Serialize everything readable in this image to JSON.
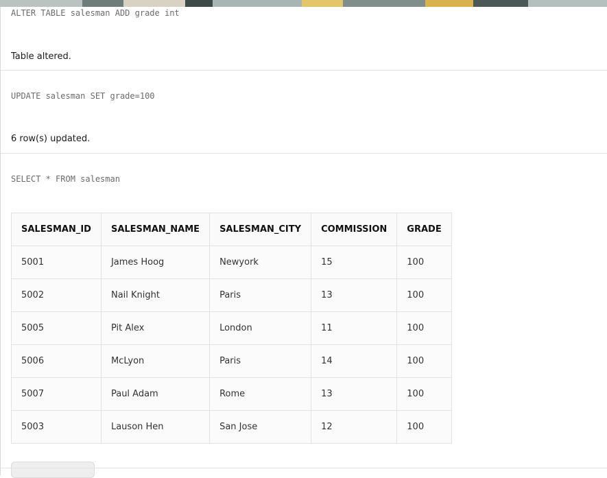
{
  "statements": [
    {
      "code": "ALTER TABLE salesman ADD grade int",
      "result": "Table altered."
    },
    {
      "code": "UPDATE salesman SET grade=100",
      "result": "6 row(s) updated."
    },
    {
      "code": "SELECT * FROM salesman",
      "result": ""
    }
  ],
  "table": {
    "headers": [
      "SALESMAN_ID",
      "SALESMAN_NAME",
      "SALESMAN_CITY",
      "COMMISSION",
      "GRADE"
    ],
    "rows": [
      [
        "5001",
        "James Hoog",
        "Newyork",
        "15",
        "100"
      ],
      [
        "5002",
        "Nail Knight",
        "Paris",
        "13",
        "100"
      ],
      [
        "5005",
        "Pit Alex",
        "London",
        "11",
        "100"
      ],
      [
        "5006",
        "McLyon",
        "Paris",
        "14",
        "100"
      ],
      [
        "5007",
        "Paul Adam",
        "Rome",
        "13",
        "100"
      ],
      [
        "5003",
        "Lauson Hen",
        "San Jose",
        "12",
        "100"
      ]
    ]
  },
  "colors": {
    "code_text": "#6b6b6b",
    "divider": "#e2e2e2",
    "banner": "#9aa9a6"
  }
}
